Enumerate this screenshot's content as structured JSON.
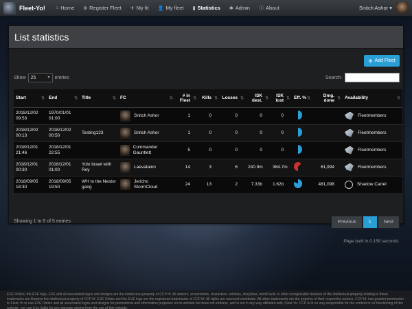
{
  "app": {
    "title": "Fleet-Yo!"
  },
  "nav": {
    "items": [
      {
        "icon": "⌂",
        "label": "Home",
        "active": false
      },
      {
        "icon": "⊕",
        "label": "Register Fleet",
        "active": false
      },
      {
        "icon": "✈",
        "label": "My fit",
        "active": false
      },
      {
        "icon": "👤",
        "label": "My fleet",
        "active": false
      },
      {
        "icon": "▮",
        "label": "Statistics",
        "active": true
      },
      {
        "icon": "✱",
        "label": "Admin",
        "active": false
      },
      {
        "icon": "ⓘ",
        "label": "About",
        "active": false
      }
    ],
    "user": "Snitch Ashor ▾"
  },
  "panel": {
    "title": "List statistics"
  },
  "add_button": "Add Fleet",
  "controls": {
    "show": "Show",
    "entries_value": "25",
    "entries": "entries",
    "search_label": "Search:"
  },
  "table": {
    "headers": [
      "Start",
      "End",
      "Title",
      "FC",
      "# in Fleet",
      "Kills",
      "Losses",
      "ISK dest.",
      "ISK lost",
      "Eff. %",
      "Dmg. done",
      "Availability"
    ],
    "rows": [
      {
        "start": "2018/12/02 09:53",
        "end": "1970/01/01 01:00",
        "title": "",
        "fc": "Snitch Ashor",
        "fleet": "1",
        "kills": "0",
        "losses": "0",
        "isk_dest": "0",
        "isk_lost": "0",
        "eff": 0.5,
        "dmg": "",
        "avail": "Fleetmembers",
        "avail_icon": "ship-icon"
      },
      {
        "start": "2018/12/02 00:13",
        "end": "2018/12/02 00:50",
        "title": "Testing123",
        "fc": "Snitch Ashor",
        "fleet": "1",
        "kills": "0",
        "losses": "0",
        "isk_dest": "0",
        "isk_lost": "0",
        "eff": 0.5,
        "dmg": "",
        "avail": "Fleetmembers",
        "avail_icon": "ship-icon"
      },
      {
        "start": "2018/12/01 21:46",
        "end": "2018/12/01 22:55",
        "title": "",
        "fc": "Commander Gauntlett",
        "fleet": "5",
        "kills": "0",
        "losses": "0",
        "isk_dest": "0",
        "isk_lost": "0",
        "eff": 0.5,
        "dmg": "",
        "avail": "Fleetmembers",
        "avail_icon": "ship-icon"
      },
      {
        "start": "2018/12/01 00:30",
        "end": "2018/12/01 01:00",
        "title": "Yolo brawl with Roy",
        "fc": "Laevatainn",
        "fleet": "14",
        "kills": "3",
        "losses": "6",
        "isk_dest": "240.9m",
        "isk_lost": "384.7m",
        "eff": 0.38,
        "dmg": "61,994",
        "avail": "Fleetmembers",
        "avail_icon": "ship-icon"
      },
      {
        "start": "2018/09/05 18:30",
        "end": "2018/09/05 19:50",
        "title": "WH to the Nestor gang",
        "fc": "Jericho StormCloud",
        "fleet": "24",
        "kills": "13",
        "losses": "2",
        "isk_dest": "7.33b",
        "isk_lost": "1.62b",
        "eff": 0.82,
        "dmg": "481,098",
        "avail": "Shadow Cartel",
        "avail_icon": "shadow-cartel-icon"
      }
    ]
  },
  "info": "Showing 1 to 5 of 5 entries",
  "pager": {
    "prev": "Previous",
    "page": "1",
    "next": "Next"
  },
  "built": "Page built in 0.159 seconds.",
  "footer": "EVE Online, the EVE logo, EVE and all associated logos and designs are the intellectual property of CCP hf. All artwork, screenshots, characters, vehicles, storylines, world facts or other recognizable features of the intellectual property relating to these trademarks are likewise the intellectual property of CCP hf. EVE Online and the EVE logo are the registered trademarks of CCP hf. All rights are reserved worldwide. All other trademarks are the property of their respective owners. CCP hf. has granted permission to Fleet-Yo to use EVE Online and all associated logos and designs for promotional and information purposes on its website but does not endorse, and is not in any way affiliated with, Fleet-Yo. CCP is in no way responsible for the content on or functioning of this website, nor can it be liable for any damage arising from the use of this website.",
  "colors": {
    "accent": "#2a9fd6",
    "eff_positive": "#2a9fd6",
    "eff_negative": "#c9302c"
  }
}
